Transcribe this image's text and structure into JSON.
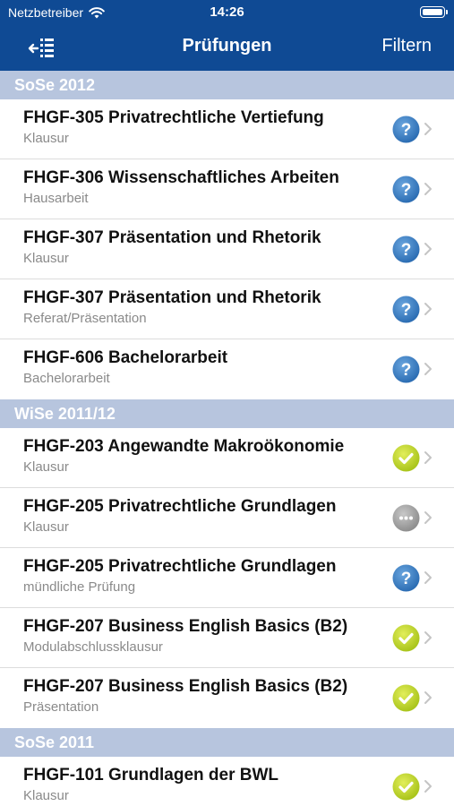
{
  "status_bar": {
    "carrier": "Netzbetreiber",
    "time": "14:26"
  },
  "navbar": {
    "title": "Prüfungen",
    "right_label": "Filtern",
    "left_icon": "collapse-list-icon"
  },
  "colors": {
    "navbar": "#0f4a94",
    "section_header": "#b7c5de",
    "pending": "#3a7fc4",
    "passed": "#bfd62d",
    "unknown": "#a0a0a0"
  },
  "sections": [
    {
      "header": "SoSe 2012",
      "rows": [
        {
          "title": "FHGF-305 Privatrechtliche Vertiefung",
          "subtitle": "Klausur",
          "status": "pending"
        },
        {
          "title": "FHGF-306 Wissenschaftliches Arbeiten",
          "subtitle": "Hausarbeit",
          "status": "pending"
        },
        {
          "title": "FHGF-307 Präsentation und Rhetorik",
          "subtitle": "Klausur",
          "status": "pending"
        },
        {
          "title": "FHGF-307 Präsentation und Rhetorik",
          "subtitle": "Referat/Präsentation",
          "status": "pending"
        },
        {
          "title": "FHGF-606 Bachelorarbeit",
          "subtitle": "Bachelorarbeit",
          "status": "pending"
        }
      ]
    },
    {
      "header": "WiSe 2011/12",
      "rows": [
        {
          "title": "FHGF-203 Angewandte Makroökonomie",
          "subtitle": "Klausur",
          "status": "passed"
        },
        {
          "title": "FHGF-205 Privatrechtliche Grundlagen",
          "subtitle": "Klausur",
          "status": "unknown"
        },
        {
          "title": "FHGF-205 Privatrechtliche Grundlagen",
          "subtitle": "mündliche Prüfung",
          "status": "pending"
        },
        {
          "title": "FHGF-207 Business English Basics (B2)",
          "subtitle": "Modulabschlussklausur",
          "status": "passed"
        },
        {
          "title": "FHGF-207 Business English Basics (B2)",
          "subtitle": "Präsentation",
          "status": "passed"
        }
      ]
    },
    {
      "header": "SoSe 2011",
      "rows": [
        {
          "title": "FHGF-101 Grundlagen der BWL",
          "subtitle": "Klausur",
          "status": "passed"
        }
      ]
    }
  ]
}
